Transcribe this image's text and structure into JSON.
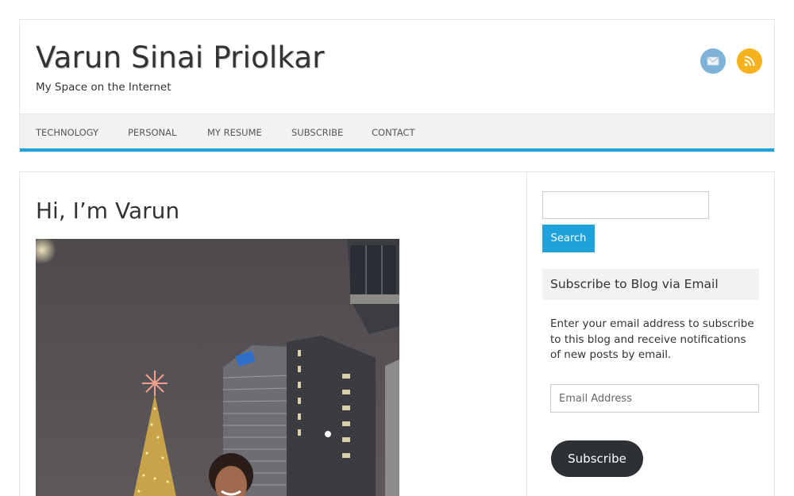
{
  "header": {
    "site_title": "Varun Sinai Priolkar",
    "site_description": "My Space on the Internet"
  },
  "social": [
    {
      "icon": "email-icon",
      "color": "#7fb2d8"
    },
    {
      "icon": "rss-icon",
      "color": "#f5b21d"
    }
  ],
  "nav": {
    "items": [
      "TECHNOLOGY",
      "PERSONAL",
      "MY RESUME",
      "SUBSCRIBE",
      "CONTACT"
    ],
    "accent_color": "#1fa1dc"
  },
  "post": {
    "title": "Hi, I’m Varun"
  },
  "sidebar": {
    "search": {
      "value": "",
      "button_label": "Search"
    },
    "subscribe_widget": {
      "title": "Subscribe to Blog via Email",
      "text": "Enter your email address to subscribe to this blog and receive notifications of new posts by email.",
      "email_placeholder": "Email Address",
      "button_label": "Subscribe"
    }
  }
}
